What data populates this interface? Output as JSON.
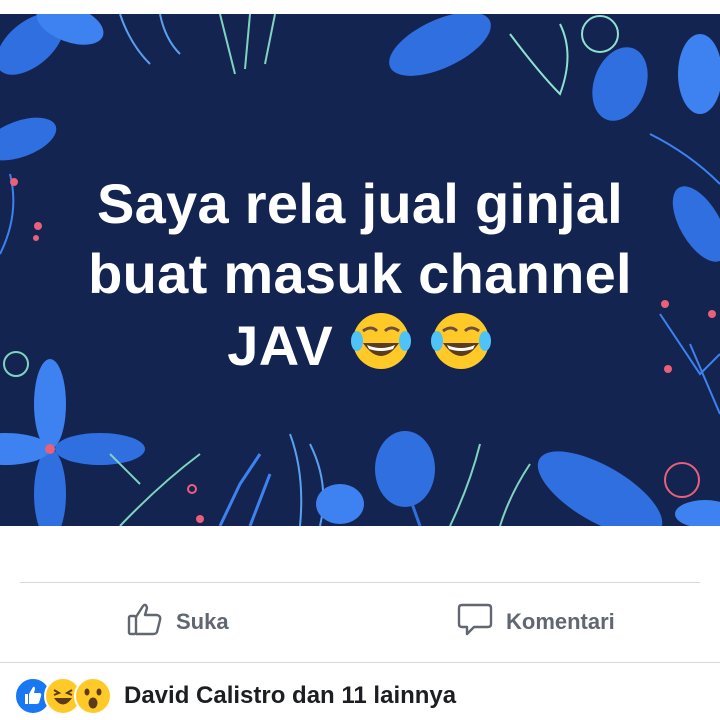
{
  "post": {
    "lines": [
      "Saya rela jual ginjal",
      "buat masuk channel",
      "JAV"
    ],
    "emojis": [
      "tears-of-joy-icon",
      "tears-of-joy-icon"
    ],
    "background_color": "#142450",
    "accent_color": "#2f6fe0"
  },
  "actions": {
    "like_label": "Suka",
    "comment_label": "Komentari"
  },
  "reactions": {
    "icons": [
      "like-reaction-icon",
      "haha-reaction-icon",
      "wow-reaction-icon"
    ],
    "text": "David Calistro dan 11 lainnya"
  }
}
